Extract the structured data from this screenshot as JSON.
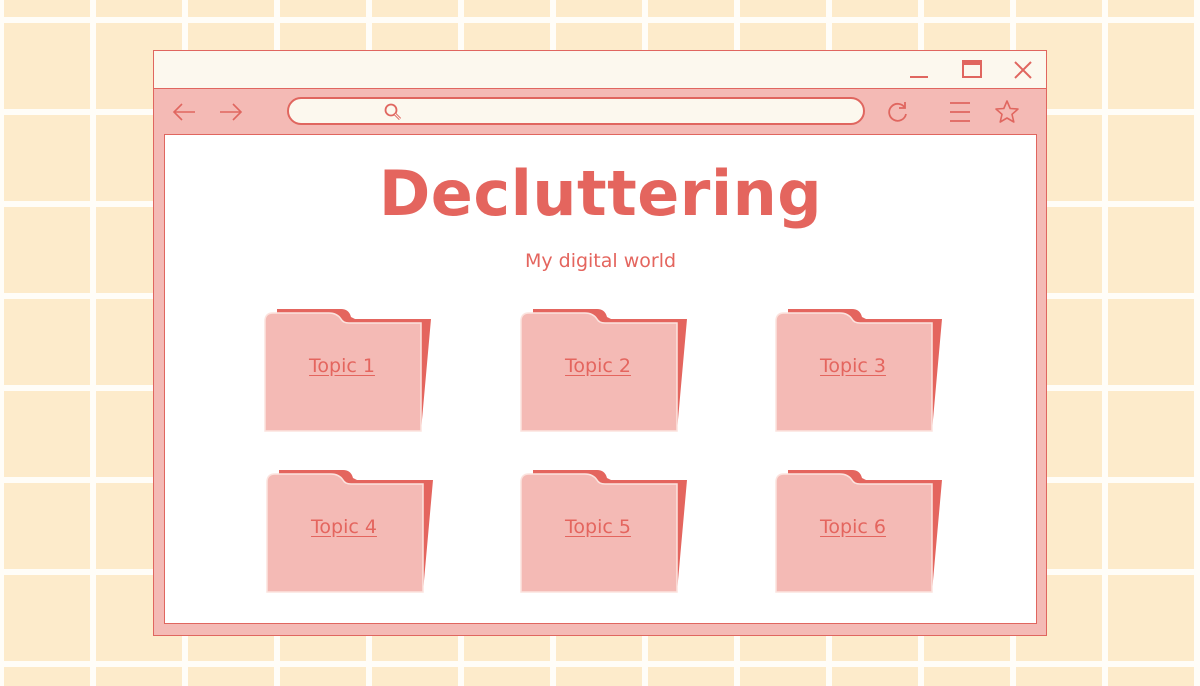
{
  "window": {
    "controls": {
      "minimize_icon": "minimize-icon",
      "maximize_icon": "maximize-icon",
      "close_icon": "close-icon"
    },
    "toolbar": {
      "back_icon": "arrow-left-icon",
      "forward_icon": "arrow-right-icon",
      "address_bar": {
        "value": "",
        "icon": "search-icon"
      },
      "refresh_icon": "refresh-icon",
      "menu_icon": "hamburger-menu-icon",
      "bookmark_icon": "star-icon"
    }
  },
  "page": {
    "title": "Decluttering",
    "subtitle": "My digital world",
    "folders": [
      {
        "label": "Topic 1"
      },
      {
        "label": "Topic 2"
      },
      {
        "label": "Topic 3"
      },
      {
        "label": "Topic 4"
      },
      {
        "label": "Topic 5"
      },
      {
        "label": "Topic 6"
      }
    ]
  },
  "colors": {
    "background": "#FDEBCB",
    "grid_lines": "#FFFDF8",
    "accent": "#E4655E",
    "folder_front": "#F4BAB5",
    "folder_back": "#E4655E",
    "titlebar": "#FCF8EE",
    "toolbar": "#F4BAB5"
  }
}
